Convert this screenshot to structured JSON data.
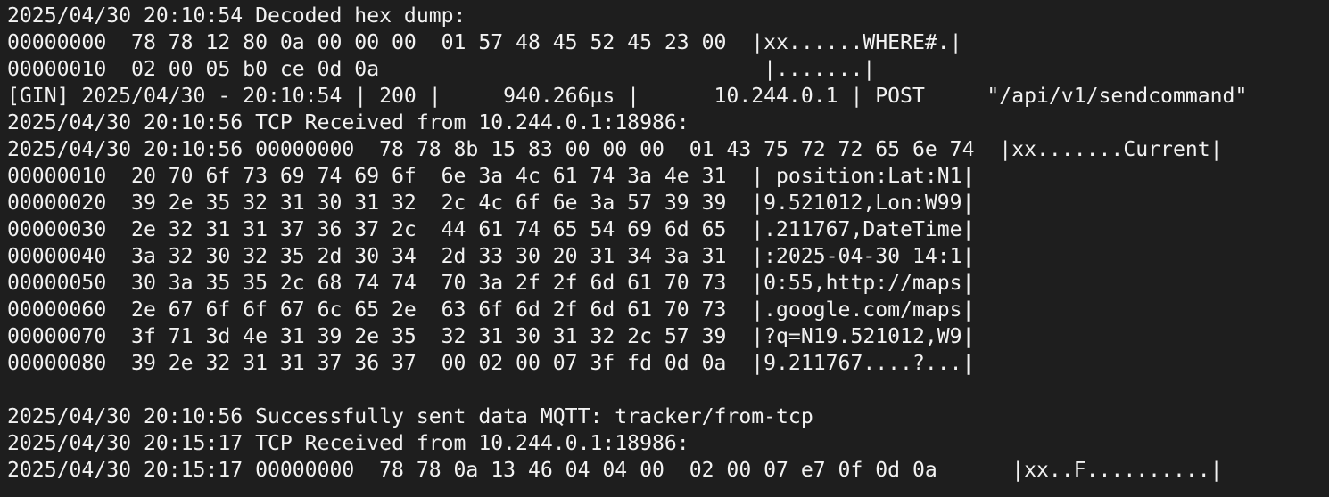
{
  "terminal": {
    "lines": [
      "2025/04/30 20:10:54 Decoded hex dump:",
      "00000000  78 78 12 80 0a 00 00 00  01 57 48 45 52 45 23 00  |xx......WHERE#.|",
      "00000010  02 00 05 b0 ce 0d 0a                               |.......|",
      "[GIN] 2025/04/30 - 20:10:54 | 200 |     940.266µs |      10.244.0.1 | POST     \"/api/v1/sendcommand\"",
      "2025/04/30 20:10:56 TCP Received from 10.244.0.1:18986:",
      "2025/04/30 20:10:56 00000000  78 78 8b 15 83 00 00 00  01 43 75 72 72 65 6e 74  |xx.......Current|",
      "00000010  20 70 6f 73 69 74 69 6f  6e 3a 4c 61 74 3a 4e 31  | position:Lat:N1|",
      "00000020  39 2e 35 32 31 30 31 32  2c 4c 6f 6e 3a 57 39 39  |9.521012,Lon:W99|",
      "00000030  2e 32 31 31 37 36 37 2c  44 61 74 65 54 69 6d 65  |.211767,DateTime|",
      "00000040  3a 32 30 32 35 2d 30 34  2d 33 30 20 31 34 3a 31  |:2025-04-30 14:1|",
      "00000050  30 3a 35 35 2c 68 74 74  70 3a 2f 2f 6d 61 70 73  |0:55,http://maps|",
      "00000060  2e 67 6f 6f 67 6c 65 2e  63 6f 6d 2f 6d 61 70 73  |.google.com/maps|",
      "00000070  3f 71 3d 4e 31 39 2e 35  32 31 30 31 32 2c 57 39  |?q=N19.521012,W9|",
      "00000080  39 2e 32 31 31 37 36 37  00 02 00 07 3f fd 0d 0a  |9.211767....?...|",
      "",
      "2025/04/30 20:10:56 Successfully sent data MQTT: tracker/from-tcp",
      "2025/04/30 20:15:17 TCP Received from 10.244.0.1:18986:",
      "2025/04/30 20:15:17 00000000  78 78 0a 13 46 04 04 00  02 00 07 e7 0f 0d 0a      |xx..F..........|"
    ]
  }
}
